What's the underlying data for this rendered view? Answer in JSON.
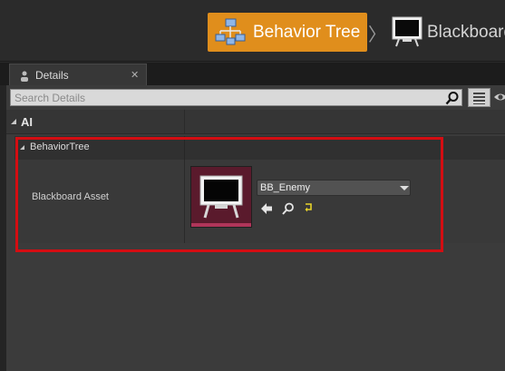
{
  "breadcrumb": {
    "behavior_tree": {
      "label": "Behavior Tree",
      "icon": "behavior-tree-icon",
      "color": "#e08e1c"
    },
    "separator": "〉",
    "blackboard": {
      "label": "Blackboard",
      "icon": "blackboard-icon"
    }
  },
  "details_tab": {
    "label": "Details",
    "icon": "details-icon",
    "close_label": "✕"
  },
  "search": {
    "placeholder": "Search Details",
    "value": ""
  },
  "categories": {
    "ai": {
      "label": "AI",
      "expanded": true
    },
    "behavior_tree": {
      "label": "BehaviorTree",
      "expanded": true
    }
  },
  "property": {
    "name": "Blackboard Asset",
    "value": "BB_Enemy",
    "thumbnail_icon": "blackboard-icon"
  },
  "actions": {
    "use_selected": "arrow-left-icon",
    "browse": "magnifier-icon",
    "reset": "reset-arrow-icon"
  },
  "highlight_color": "#d40d12"
}
